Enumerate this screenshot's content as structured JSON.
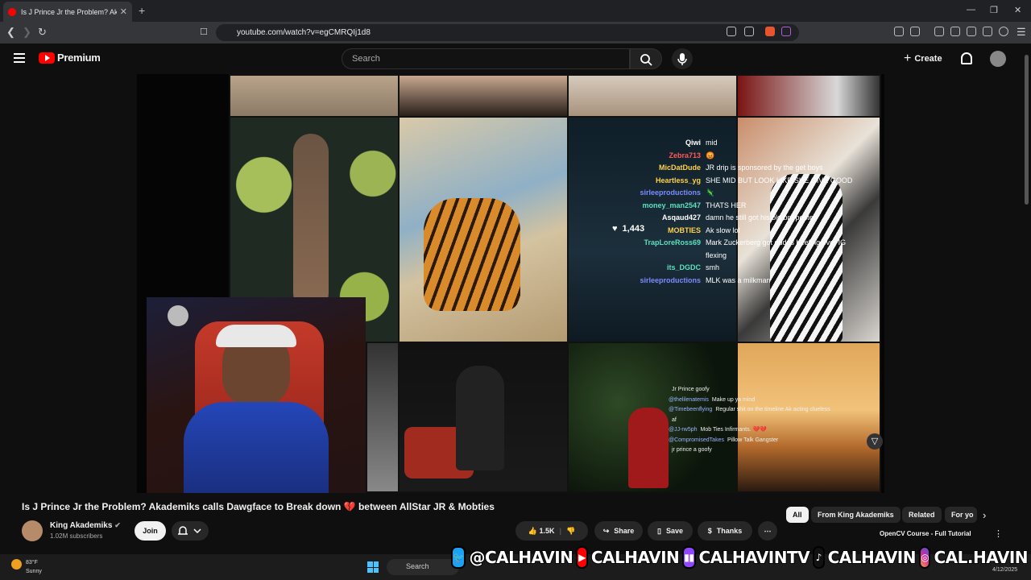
{
  "browser": {
    "tab_title": "Is J Prince Jr the Problem? Akad",
    "url": "youtube.com/watch?v=egCMRQIj1d8"
  },
  "youtube": {
    "brand": "Premium",
    "search_placeholder": "Search",
    "create_label": "Create"
  },
  "stream_chat": [
    {
      "user": "Qiwi",
      "msg": "mid",
      "color": "#ffffff"
    },
    {
      "user": "Zebra713",
      "msg": "😡",
      "color": "#ff5a5a"
    },
    {
      "user": "MicDatDude",
      "msg": "JR drip is sponsored by the get boys",
      "color": "#ffd24a"
    },
    {
      "user": "Heartless_yg",
      "msg": "SHE MID BUT LOOK LIKE SHE GIVE GOOD",
      "color": "#ffd24a"
    },
    {
      "user": "sirleeproductions",
      "msg": "🦎",
      "color": "#7a8cff"
    },
    {
      "user": "money_man2547",
      "msg": "THATS HER",
      "color": "#5de0c0"
    },
    {
      "user": "Asqaud427",
      "msg": "damn he still got his old bm posted",
      "color": "#ffffff"
    },
    {
      "user": "MOBTIES",
      "msg": "Ak slow lol",
      "color": "#ffd24a"
    },
    {
      "user": "TrapLoreRoss69",
      "msg": "Mark Zuckerberg got dudes beefing over IG",
      "color": "#5de0c0"
    },
    {
      "user": "",
      "msg": "flexing",
      "color": "#ffffff"
    },
    {
      "user": "its_DGDC",
      "msg": "smh",
      "color": "#5de0c0"
    },
    {
      "user": "sirleeproductions",
      "msg": "MLK was a milkman",
      "color": "#7a8cff"
    }
  ],
  "stream_likes": "1,443",
  "stream_chat_2": [
    {
      "user": "",
      "msg": "Jr Prince goofy"
    },
    {
      "user": "@thelilenatemis",
      "msg": "Make up ya mind"
    },
    {
      "user": "@Timebeenflying",
      "msg": "Regular shit on the timeline Ak acting clueless"
    },
    {
      "user": "",
      "msg": "af"
    },
    {
      "user": "@JJ-rw5ph",
      "msg": "Mob Ties Infirmants. 💔💔"
    },
    {
      "user": "@CompromisedTakes",
      "msg": "Pillow Talk Gangster"
    },
    {
      "user": "",
      "msg": "jr prince a goofy"
    }
  ],
  "video": {
    "title": "Is J Prince Jr the Problem? Akademiks calls Dawgface to Break down 💔 between AllStar JR & Mobties",
    "channel": "King Akademiks",
    "subscribers": "1.02M subscribers",
    "join_label": "Join",
    "likes": "1.5K",
    "share_label": "Share",
    "save_label": "Save",
    "thanks_label": "Thanks"
  },
  "chips": [
    "All",
    "From King Akademiks",
    "Related",
    "For yo"
  ],
  "recommendation": "OpenCV Course - Full Tutorial",
  "taskbar": {
    "temp": "83°F",
    "condition": "Sunny",
    "search": "Search",
    "date": "4/12/2025"
  },
  "banner": {
    "twitter": "@CALHAVIN",
    "youtube": "CALHAVIN",
    "twitch": "CALHAVINTV",
    "tiktok": "CALHAVIN",
    "instagram": "CAL.HAVIN"
  },
  "colors": {
    "accent": "#ff0000",
    "bg": "#0f0f0f",
    "chip_bg": "#272727"
  }
}
